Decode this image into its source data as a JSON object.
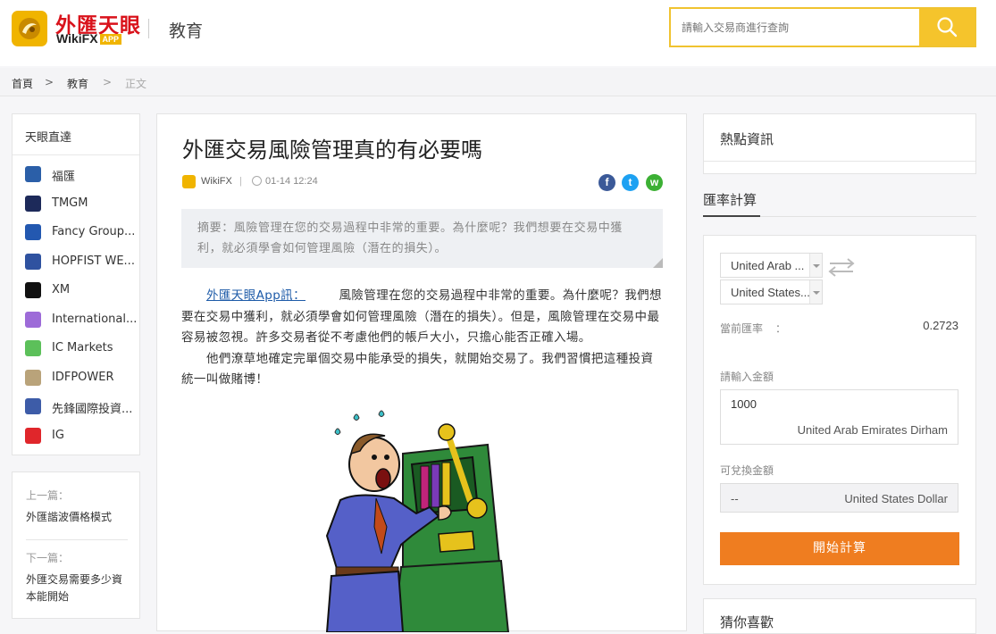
{
  "header": {
    "logo_cn": "外匯天眼",
    "logo_en": "WikiFX",
    "logo_app": "APP",
    "section": "教育",
    "search_placeholder": "請輸入交易商進行查詢"
  },
  "breadcrumb": {
    "home": "首頁",
    "sep": ">",
    "section": "教育",
    "current": "正文"
  },
  "sidebar": {
    "title": "天眼直達",
    "brokers": [
      {
        "name": "福匯",
        "icon": "fxcm-logo-icon",
        "color": "#2b5fa8"
      },
      {
        "name": "TMGM",
        "icon": "tmgm-logo-icon",
        "color": "#1d2a5a"
      },
      {
        "name": "Fancy Group...",
        "icon": "fancy-group-logo-icon",
        "color": "#2358b0"
      },
      {
        "name": "HOPFIST WE...",
        "icon": "hopfist-logo-icon",
        "color": "#2f52a0"
      },
      {
        "name": "XM",
        "icon": "xm-logo-icon",
        "color": "#111111"
      },
      {
        "name": "International...",
        "icon": "international-logo-icon",
        "color": "#9d6bd8"
      },
      {
        "name": "IC Markets",
        "icon": "ic-markets-logo-icon",
        "color": "#5cc05a"
      },
      {
        "name": "IDFPOWER",
        "icon": "idfpower-logo-icon",
        "color": "#b9a37a"
      },
      {
        "name": "先鋒國際投資...",
        "icon": "pioneer-logo-icon",
        "color": "#3d5ca8"
      },
      {
        "name": "IG",
        "icon": "ig-logo-icon",
        "color": "#e0262b"
      }
    ]
  },
  "prevnext": {
    "prev_label": "上一篇：",
    "prev_title": "外匯諧波價格模式",
    "next_label": "下一篇：",
    "next_title": "外匯交易需要多少資本能開始"
  },
  "article": {
    "title": "外匯交易風險管理真的有必要嗎",
    "author": "WikiFX",
    "separator": "|",
    "time": "01-14 12:24",
    "summary": "摘要：風險管理在您的交易過程中非常的重要。為什麼呢？我們想要在交易中獲利，就必須學會如何管理風險（潛在的損失）。",
    "source_link": "外匯天眼App訊：",
    "paragraph1": "風險管理在您的交易過程中非常的重要。為什麼呢？我們想要在交易中獲利，就必須學會如何管理風險（潛在的損失）。但是，風險管理在交易中最容易被忽視。許多交易者從不考慮他們的帳戶大小，只擔心能否正確入場。",
    "paragraph2": "他們潦草地確定完單個交易中能承受的損失，就開始交易了。我們習慣把這種投資統一叫做賭博！"
  },
  "right": {
    "hot_title": "熱點資訊",
    "rate_tab": "匯率計算",
    "from_currency": "United Arab ...",
    "to_currency": "United States...",
    "rate_label": "當前匯率",
    "rate_colon": "：",
    "rate_value": "0.2723",
    "amount_label": "請輸入金額",
    "amount_value": "1000",
    "amount_currency": "United Arab Emirates Dirham",
    "converted_label": "可兌換金額",
    "converted_value": "--",
    "converted_currency": "United States Dollar",
    "calc_button": "開始計算",
    "like_title": "猜你喜歡"
  },
  "colors": {
    "brand_yellow": "#f5c42c",
    "calc_orange": "#ef7d20",
    "link_blue": "#1e5ba8"
  }
}
